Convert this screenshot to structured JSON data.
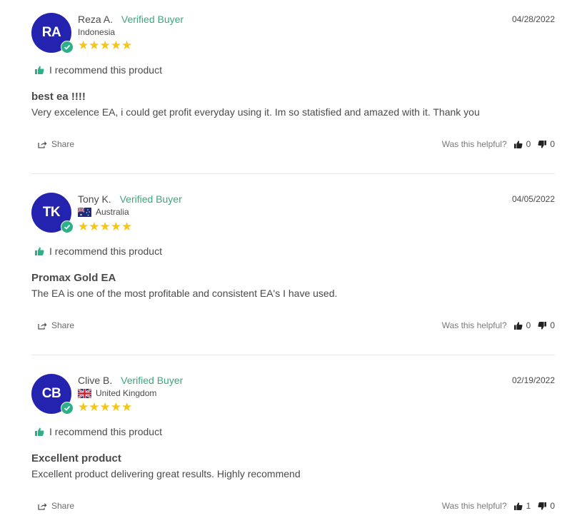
{
  "reviews": [
    {
      "initials": "RA",
      "name": "Reza A.",
      "verified": "Verified Buyer",
      "location": "Indonesia",
      "flag": "",
      "rating": 5,
      "date": "04/28/2022",
      "recommend": "I recommend this product",
      "title": "best ea !!!!",
      "body": "Very excelence EA, i could get profit everyday using it. Im so statisfied and amazed with it. Thank you",
      "share_label": "Share",
      "helpful_label": "Was this helpful?",
      "up_votes": "0",
      "down_votes": "0"
    },
    {
      "initials": "TK",
      "name": "Tony K.",
      "verified": "Verified Buyer",
      "location": "Australia",
      "flag": "australia-flag-icon",
      "rating": 5,
      "date": "04/05/2022",
      "recommend": "I recommend this product",
      "title": "Promax Gold EA",
      "body": "The EA is one of the most profitable and consistent EA's I have used.",
      "share_label": "Share",
      "helpful_label": "Was this helpful?",
      "up_votes": "0",
      "down_votes": "0"
    },
    {
      "initials": "CB",
      "name": "Clive B.",
      "verified": "Verified Buyer",
      "location": "United Kingdom",
      "flag": "uk-flag-icon",
      "rating": 5,
      "date": "02/19/2022",
      "recommend": "I recommend this product",
      "title": "Excellent product",
      "body": "Excellent product delivering great results. Highly recommend",
      "share_label": "Share",
      "helpful_label": "Was this helpful?",
      "up_votes": "1",
      "down_votes": "0"
    }
  ],
  "colors": {
    "avatar": "#2323b0",
    "verified": "#3aa87a",
    "stars": "#f5c518"
  }
}
